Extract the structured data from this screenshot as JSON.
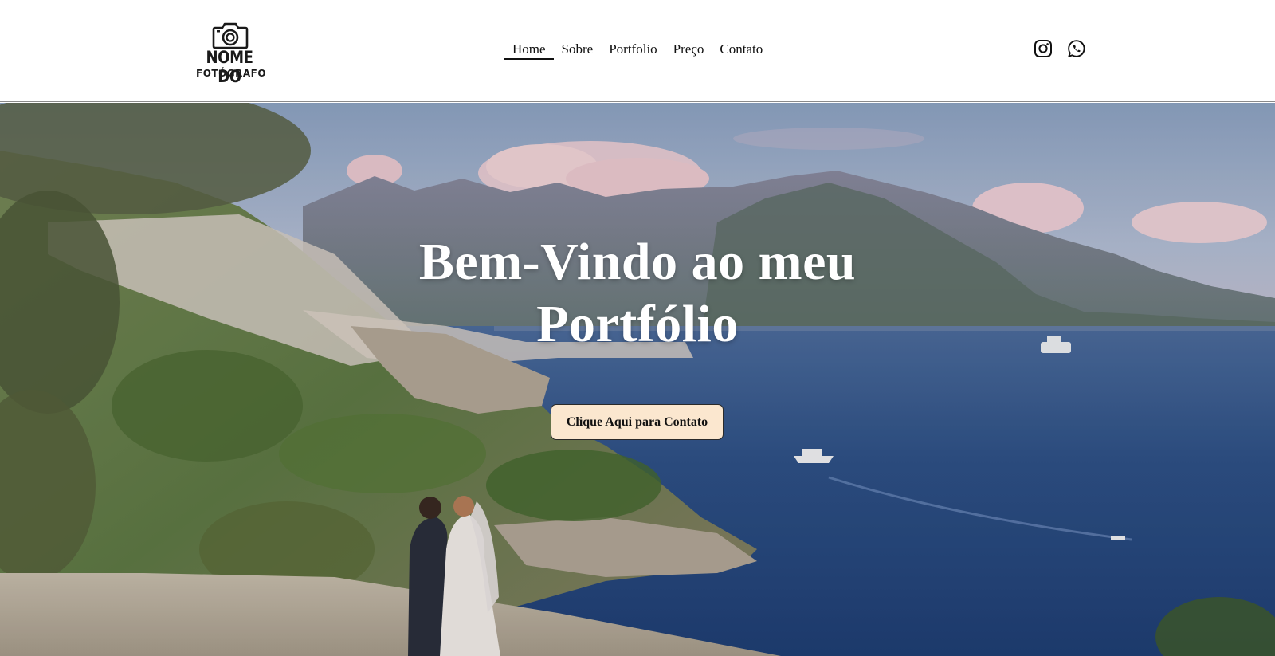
{
  "brand": {
    "logo_line1": "NOME DO",
    "logo_line2": "FOTÓGRAFO",
    "logo_icon": "camera-icon"
  },
  "nav": {
    "items": [
      {
        "label": "Home",
        "active": true
      },
      {
        "label": "Sobre",
        "active": false
      },
      {
        "label": "Portfolio",
        "active": false
      },
      {
        "label": "Preço",
        "active": false
      },
      {
        "label": "Contato",
        "active": false
      }
    ]
  },
  "social": {
    "icons": [
      "instagram-icon",
      "whatsapp-icon"
    ]
  },
  "hero": {
    "title": "Bem-Vindo ao meu Portfólio",
    "cta_label": "Clique Aqui para Contato"
  },
  "colors": {
    "header_bg": "#ffffff",
    "text": "#111111",
    "cta_bg": "#fbe7cf",
    "hero_title": "#ffffff",
    "sea": "#2c4f86",
    "sky": "#a9b8d2"
  }
}
